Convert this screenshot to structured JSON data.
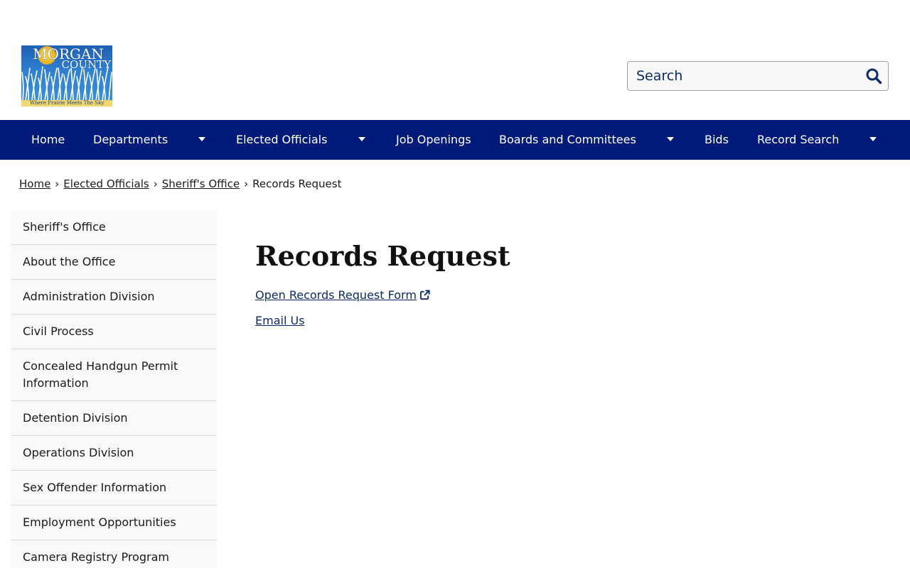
{
  "logo": {
    "title_line1": "MORGAN",
    "title_line2": "COUNTY",
    "tagline": "Where Prairie Meets The Sky"
  },
  "search": {
    "placeholder": "Search"
  },
  "nav": {
    "items": [
      {
        "label": "Home",
        "has_dropdown": false
      },
      {
        "label": "Departments",
        "has_dropdown": true
      },
      {
        "label": "Elected Officials",
        "has_dropdown": true
      },
      {
        "label": "Job Openings",
        "has_dropdown": false
      },
      {
        "label": "Boards and Committees",
        "has_dropdown": true
      },
      {
        "label": "Bids",
        "has_dropdown": false
      },
      {
        "label": "Record Search",
        "has_dropdown": true
      }
    ]
  },
  "breadcrumb": {
    "items": [
      "Home",
      "Elected Officials",
      "Sheriff's Office"
    ],
    "current": "Records Request",
    "separator": "›"
  },
  "sidebar": {
    "items": [
      "Sheriff's Office",
      "About the Office",
      "Administration Division",
      "Civil Process",
      "Concealed Handgun Permit Information",
      "Detention Division",
      "Operations Division",
      "Sex Offender Information",
      "Employment Opportunities",
      "Camera Registry Program"
    ]
  },
  "main": {
    "title": "Records Request",
    "links": [
      {
        "label": "Open Records Request Form",
        "external": true
      },
      {
        "label": "Email Us",
        "external": false
      }
    ]
  },
  "colors": {
    "nav_bg": "#001a7a",
    "link": "#0b2a66",
    "sidebar_bg": "#f9f9f9"
  }
}
